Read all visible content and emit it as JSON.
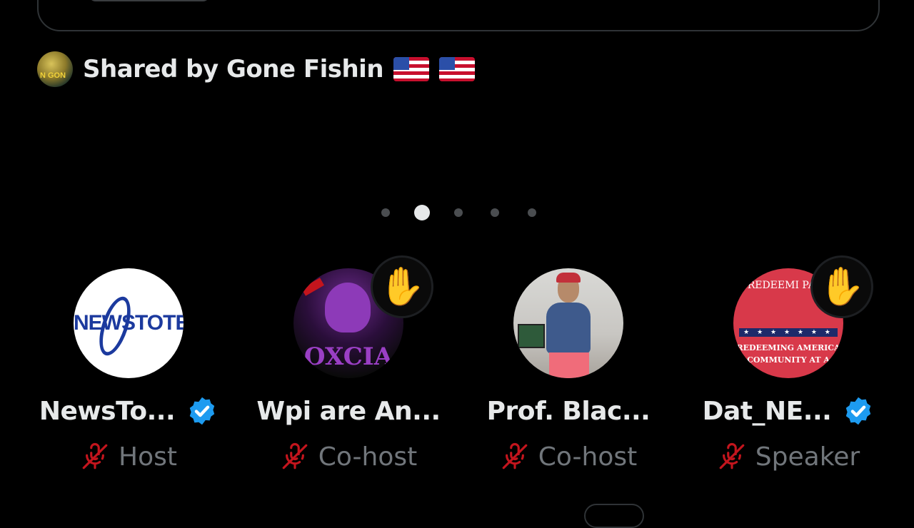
{
  "shared": {
    "text": "Shared by Gone Fishin",
    "avatar_text": "N GON",
    "flags": [
      "🇺🇸",
      "🇺🇸"
    ]
  },
  "carousel": {
    "page_count": 5,
    "active_index": 1
  },
  "speakers": [
    {
      "name": "NewsTo...",
      "role": "Host",
      "verified": true,
      "hand_raised": false,
      "avatar_text": "NEWSTOTER"
    },
    {
      "name": "Wpi are An...",
      "role": "Co-host",
      "verified": false,
      "hand_raised": true,
      "avatar_text": "OXCIA"
    },
    {
      "name": "Prof. Blac...",
      "role": "Co-host",
      "verified": false,
      "hand_raised": false
    },
    {
      "name": "Dat_NE...",
      "role": "Speaker",
      "verified": true,
      "hand_raised": true,
      "avatar_text_top": "REDEEMI PART",
      "avatar_text_bottom": "REDEEMING AMERICA COMMUNITY AT A"
    }
  ],
  "colors": {
    "background": "#000000",
    "text_primary": "#e7e9ea",
    "text_secondary": "#71767b",
    "verified": "#1d9bf0",
    "mic_off": "#c3151d",
    "dot_inactive": "#4a4d50",
    "dot_active": "#e7e9ea"
  },
  "icons": {
    "verified": "verified-badge-icon",
    "mic_off": "mic-off-icon",
    "hand": "raised-hand-icon"
  },
  "hand_emoji": "✋"
}
